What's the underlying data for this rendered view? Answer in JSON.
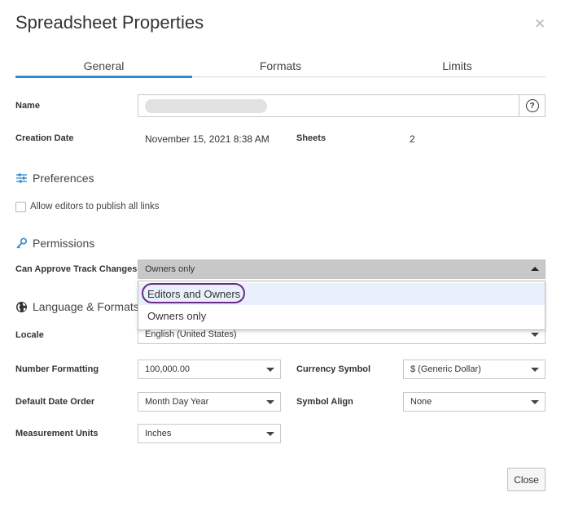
{
  "dialog": {
    "title": "Spreadsheet Properties",
    "close_icon": "close-icon"
  },
  "tabs": [
    {
      "label": "General",
      "active": true
    },
    {
      "label": "Formats",
      "active": false
    },
    {
      "label": "Limits",
      "active": false
    }
  ],
  "general": {
    "name_label": "Name",
    "name_value": "",
    "creation_date_label": "Creation Date",
    "creation_date_value": "November 15, 2021 8:38 AM",
    "sheets_label": "Sheets",
    "sheets_value": "2"
  },
  "preferences": {
    "heading": "Preferences",
    "allow_publish_label": "Allow editors to publish all links",
    "allow_publish_checked": false
  },
  "permissions": {
    "heading": "Permissions",
    "approve_label": "Can Approve Track Changes",
    "approve_value": "Owners only",
    "options": [
      "Editors and Owners",
      "Owners only"
    ],
    "highlighted_option": "Editors and Owners"
  },
  "language": {
    "heading": "Language & Formats",
    "locale_label": "Locale",
    "locale_value": "English (United States)",
    "number_label": "Number Formatting",
    "number_value": "100,000.00",
    "currency_label": "Currency Symbol",
    "currency_value": "$ (Generic Dollar)",
    "date_order_label": "Default Date Order",
    "date_order_value": "Month Day Year",
    "symbol_align_label": "Symbol Align",
    "symbol_align_value": "None",
    "units_label": "Measurement Units",
    "units_value": "Inches"
  },
  "footer": {
    "close_label": "Close"
  },
  "colors": {
    "tab_accent": "#2f86d1",
    "highlight_ring": "#6a2a86",
    "option_hover": "#e8f1fb"
  }
}
